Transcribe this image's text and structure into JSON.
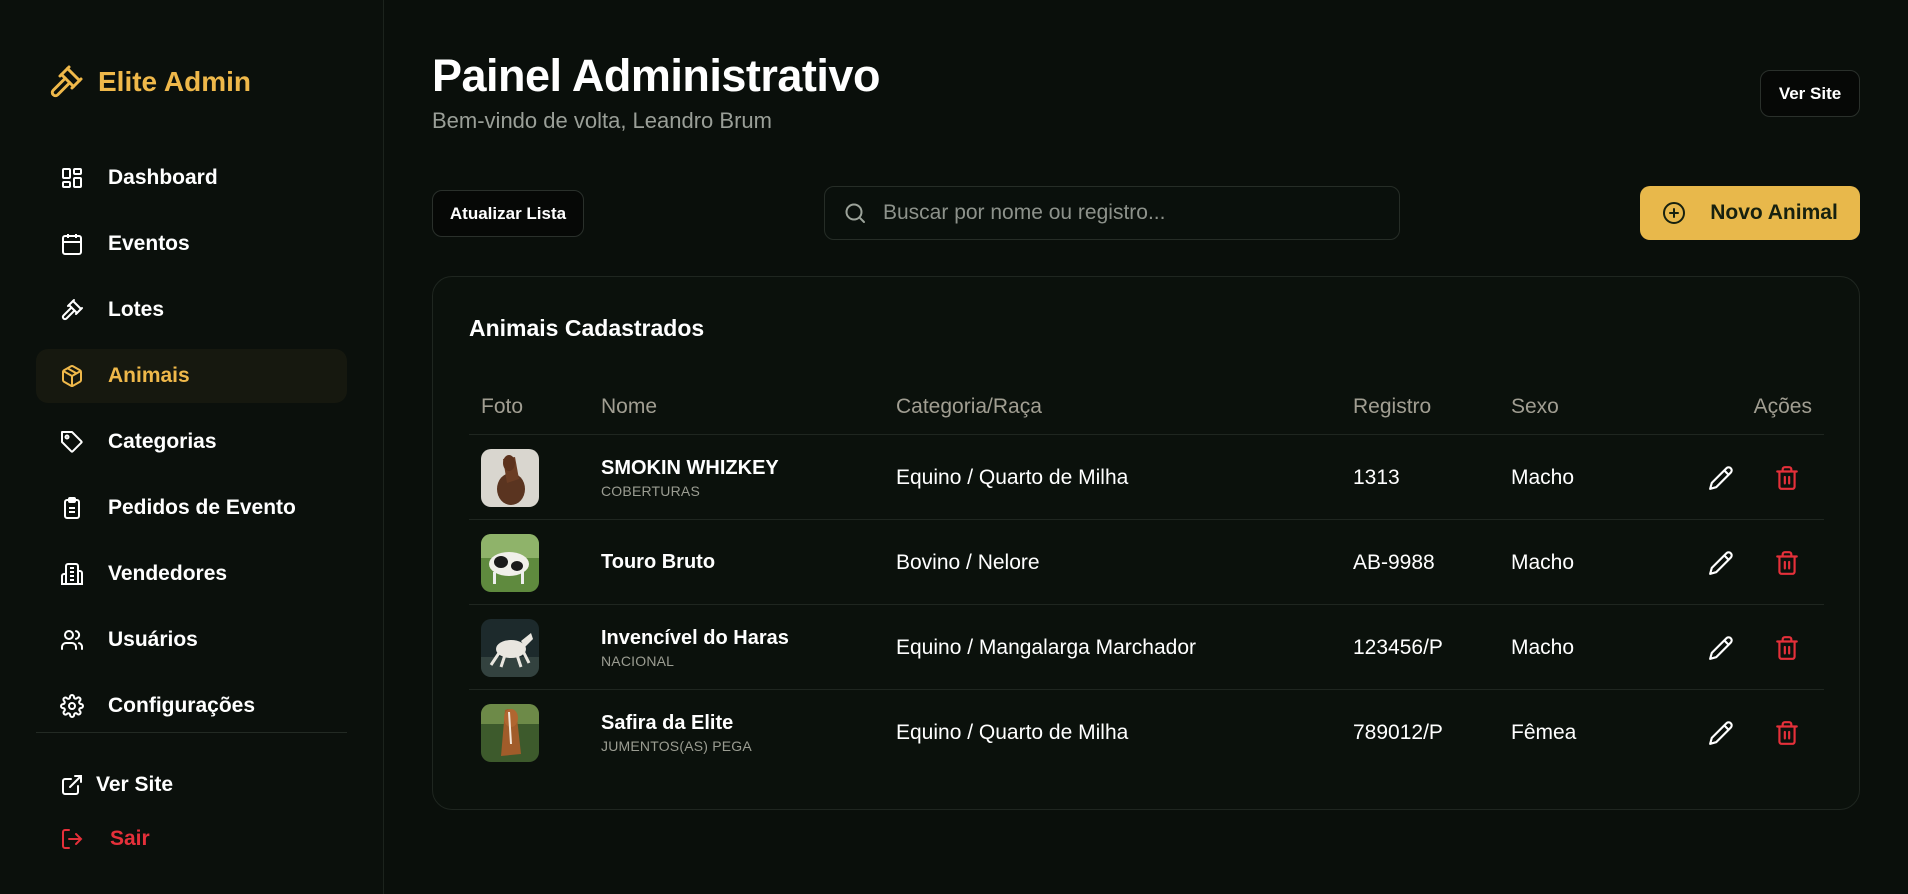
{
  "brand": {
    "name": "Elite Admin",
    "icon": "gavel-icon",
    "color": "#efb84a"
  },
  "sidebar": {
    "items": [
      {
        "label": "Dashboard",
        "icon": "dashboard-icon"
      },
      {
        "label": "Eventos",
        "icon": "calendar-icon"
      },
      {
        "label": "Lotes",
        "icon": "gavel-icon"
      },
      {
        "label": "Animais",
        "icon": "box-icon",
        "active": true
      },
      {
        "label": "Categorias",
        "icon": "tag-icon"
      },
      {
        "label": "Pedidos de Evento",
        "icon": "clipboard-icon"
      },
      {
        "label": "Vendedores",
        "icon": "building-icon"
      },
      {
        "label": "Usuários",
        "icon": "users-icon"
      },
      {
        "label": "Configurações",
        "icon": "gear-icon"
      }
    ],
    "footer": {
      "view_site": "Ver Site",
      "logout": "Sair"
    }
  },
  "header": {
    "title": "Painel Administrativo",
    "subtitle": "Bem-vindo de volta, Leandro Brum",
    "view_site_button": "Ver Site"
  },
  "toolbar": {
    "refresh_label": "Atualizar Lista",
    "search_placeholder": "Buscar por nome ou registro...",
    "new_label": "Novo Animal"
  },
  "table": {
    "title": "Animais Cadastrados",
    "columns": [
      "Foto",
      "Nome",
      "Categoria/Raça",
      "Registro",
      "Sexo",
      "Ações"
    ],
    "rows": [
      {
        "name": "SMOKIN WHIZKEY",
        "sub": "COBERTURAS",
        "category": "Equino / Quarto de Milha",
        "registry": "1313",
        "sex": "Macho"
      },
      {
        "name": "Touro Bruto",
        "sub": "",
        "category": "Bovino / Nelore",
        "registry": "AB-9988",
        "sex": "Macho"
      },
      {
        "name": "Invencível do Haras",
        "sub": "NACIONAL",
        "category": "Equino / Mangalarga Marchador",
        "registry": "123456/P",
        "sex": "Macho"
      },
      {
        "name": "Safira da Elite",
        "sub": "JUMENTOS(AS) PEGA",
        "category": "Equino / Quarto de Milha",
        "registry": "789012/P",
        "sex": "Fêmea"
      }
    ]
  },
  "colors": {
    "accent": "#efb84a",
    "button_accent": "#e8b84b",
    "danger": "#e5303a",
    "background": "#0a0f0b"
  }
}
